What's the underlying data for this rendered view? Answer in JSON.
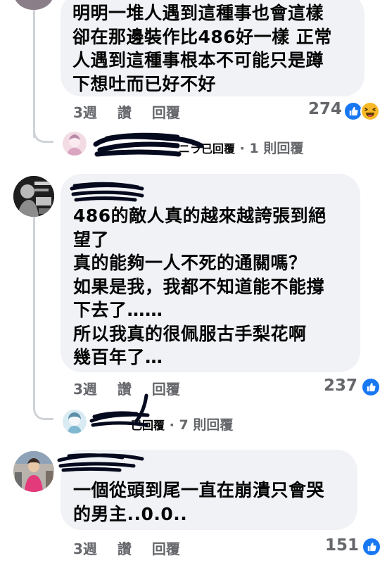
{
  "comments": [
    {
      "lines": [
        "明明一堆人遇到這種事也會這樣",
        "卻在那邊裝作比486好一樣 正常",
        "人遇到這種事根本不可能只是蹲",
        "下想吐而已好不好"
      ],
      "meta": {
        "time": "3週",
        "like_label": "讚",
        "reply_label": "回覆"
      },
      "reaction_count": "274",
      "reactions": [
        "like-icon",
        "haha-icon"
      ],
      "reply_summary": {
        "name_suffix": "ニラ已回覆",
        "separator": "·",
        "count_text": "1 則回覆"
      }
    },
    {
      "lines": [
        "486的敵人真的越來越誇張到絕",
        "望了",
        "真的能夠一人不死的通關嗎？",
        "如果是我，我都不知道能不能撐",
        "下去了……",
        "所以我真的很佩服古手梨花啊",
        "幾百年了…"
      ],
      "meta": {
        "time": "3週",
        "like_label": "讚",
        "reply_label": "回覆"
      },
      "reaction_count": "237",
      "reactions": [
        "like-icon"
      ],
      "reply_summary": {
        "name_suffix": "已回覆",
        "separator": "·",
        "count_text": "7 則回覆"
      }
    },
    {
      "lines": [
        "一個從頭到尾一直在崩潰只會哭",
        "的男主..0.0.."
      ],
      "meta": {
        "time": "3週",
        "like_label": "讚",
        "reply_label": "回覆"
      },
      "reaction_count": "151",
      "reactions": [
        "like-icon"
      ]
    }
  ],
  "colors": {
    "bubble": "#f0f2f5",
    "meta": "#65676b",
    "like": "#1877f2",
    "haha": "#f7b928",
    "scribble": "#050a1e"
  }
}
